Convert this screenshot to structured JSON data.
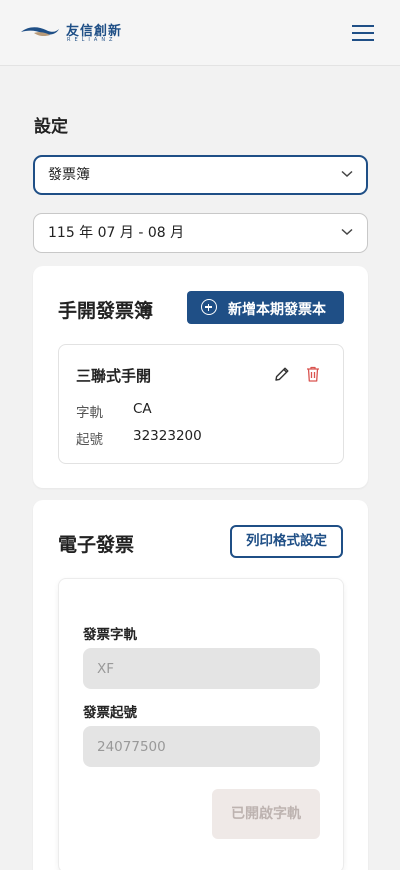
{
  "header": {
    "logo_text": "友信創新",
    "logo_sub": "RELIANZ",
    "brand_color": "#1f4f86"
  },
  "page": {
    "title": "設定"
  },
  "selects": {
    "type": {
      "value": "發票簿"
    },
    "period": {
      "value": "115 年 07 月 - 08 月"
    }
  },
  "manual_book": {
    "title": "手開發票簿",
    "add_button": "新增本期發票本",
    "item": {
      "name": "三聯式手開",
      "track_label": "字軌",
      "track_value": "CA",
      "start_label": "起號",
      "start_value": "32323200"
    }
  },
  "e_invoice": {
    "title": "電子發票",
    "print_button": "列印格式設定",
    "track_label": "發票字軌",
    "track_value": "XF",
    "start_label": "發票起號",
    "start_value": "24077500",
    "enabled_button": "已開啟字軌"
  },
  "colors": {
    "primary": "#1f4f86",
    "danger": "#d9534f",
    "disabled_bg": "#efe9e7"
  }
}
